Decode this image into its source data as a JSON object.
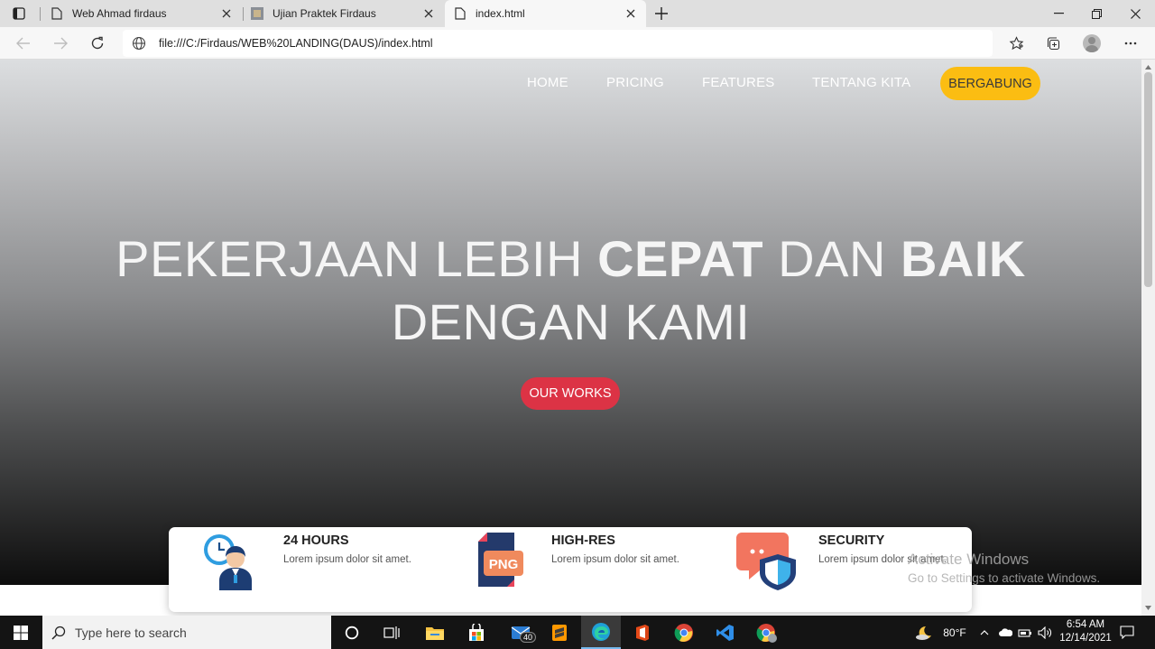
{
  "browser": {
    "tabs": [
      {
        "title": "Web Ahmad firdaus",
        "active": false
      },
      {
        "title": "Ujian Praktek Firdaus",
        "active": false
      },
      {
        "title": "index.html",
        "active": true
      }
    ],
    "url": "file:///C:/Firdaus/WEB%20LANDING(DAUS)/index.html"
  },
  "site": {
    "nav": [
      "HOME",
      "PRICING",
      "FEATURES",
      "TENTANG KITA"
    ],
    "join_label": "BERGABUNG",
    "headline": {
      "part1": "PEKERJAAN LEBIH ",
      "bold1": "CEPAT",
      "part2": " DAN ",
      "bold2": "BAIK",
      "line2": "DENGAN KAMI"
    },
    "cta_label": "OUR WORKS",
    "features": [
      {
        "title": "24 HOURS",
        "desc": "Lorem ipsum dolor sit amet."
      },
      {
        "title": "HIGH-RES",
        "desc": "Lorem ipsum dolor sit amet.",
        "badge": "PNG"
      },
      {
        "title": "SECURITY",
        "desc": "Lorem ipsum dolor sit amet."
      }
    ],
    "colors": {
      "join": "#fbbd12",
      "cta": "#dc3345"
    }
  },
  "watermark": {
    "line1": "Activate Windows",
    "line2": "Go to Settings to activate Windows."
  },
  "taskbar": {
    "search_placeholder": "Type here to search",
    "mail_badge": "40",
    "weather": "80°F",
    "time": "6:54 AM",
    "date": "12/14/2021"
  }
}
